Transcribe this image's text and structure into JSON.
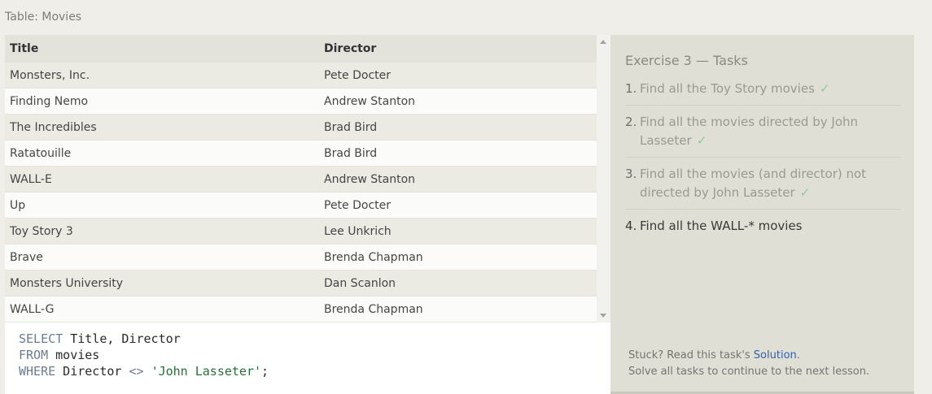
{
  "table_caption": "Table: Movies",
  "table": {
    "headers": [
      "Title",
      "Director"
    ],
    "rows": [
      [
        "Monsters, Inc.",
        "Pete Docter"
      ],
      [
        "Finding Nemo",
        "Andrew Stanton"
      ],
      [
        "The Incredibles",
        "Brad Bird"
      ],
      [
        "Ratatouille",
        "Brad Bird"
      ],
      [
        "WALL-E",
        "Andrew Stanton"
      ],
      [
        "Up",
        "Pete Docter"
      ],
      [
        "Toy Story 3",
        "Lee Unkrich"
      ],
      [
        "Brave",
        "Brenda Chapman"
      ],
      [
        "Monsters University",
        "Dan Scanlon"
      ],
      [
        "WALL-G",
        "Brenda Chapman"
      ]
    ]
  },
  "editor": {
    "l1_kw": "SELECT",
    "l1_rest": " Title, Director",
    "l2_kw": "FROM",
    "l2_rest": " movies",
    "l3_kw": "WHERE",
    "l3_a": " Director ",
    "l3_op": "<>",
    "l3_sp": " ",
    "l3_str": "'John Lasseter'",
    "l3_end": ";"
  },
  "panel": {
    "title": "Exercise 3 — Tasks",
    "tasks": [
      {
        "num": "1.",
        "text": "Find all the Toy Story movies",
        "check": "✓"
      },
      {
        "num": "2.",
        "text": "Find all the movies directed by John Lasseter",
        "check": "✓"
      },
      {
        "num": "3.",
        "text": "Find all the movies (and director) not directed by John Lasseter",
        "check": "✓"
      },
      {
        "num": "4.",
        "text": "Find all the WALL-* movies"
      }
    ],
    "footer": {
      "stuck": "Stuck? Read this task's ",
      "solution_link": "Solution",
      "period": ".",
      "note": "Solve all tasks to continue to the next lesson."
    }
  },
  "colors": {
    "panel_bg": "#e0dfd5",
    "check": "#8fc89a",
    "link": "#2f5fb3",
    "keyword": "#6b7c93",
    "string": "#2a6e3a"
  },
  "icons": [
    "scroll-up-icon",
    "scroll-down-icon",
    "checkmark-icon"
  ]
}
